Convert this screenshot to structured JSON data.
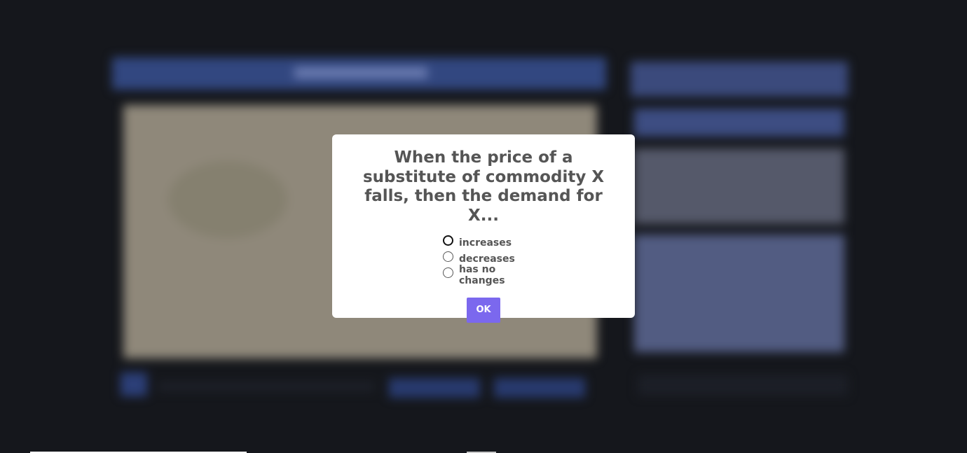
{
  "quiz": {
    "question": "When the price of a substitute of commodity X falls, then the demand for X...",
    "options": [
      {
        "label": "increases",
        "focused": true
      },
      {
        "label": "decreases",
        "focused": false
      },
      {
        "label": "has no changes",
        "focused": false
      }
    ],
    "ok_label": "OK"
  },
  "colors": {
    "backdrop": "#15171c",
    "modal_background": "#ffffff",
    "question_text": "#555555",
    "ok_button": "#7b68ee",
    "blurred_header": "#3a4f8f",
    "blurred_video": "#9b9381",
    "blurred_sidebar": "#49557e"
  }
}
